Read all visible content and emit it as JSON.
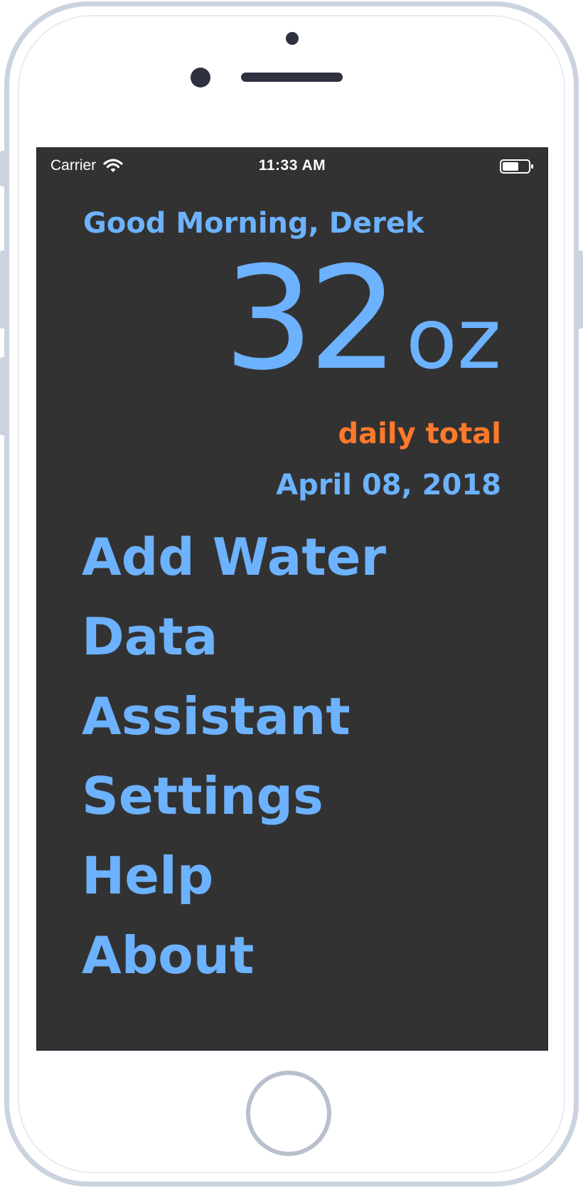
{
  "status_bar": {
    "carrier": "Carrier",
    "time": "11:33 AM",
    "wifi_icon": "wifi-icon",
    "battery_icon": "battery-icon"
  },
  "home": {
    "greeting": "Good Morning, Derek",
    "total_value": "32",
    "total_unit": "oz",
    "total_label": "daily total",
    "date": "April 08, 2018"
  },
  "menu": {
    "items": [
      {
        "label": "Add Water"
      },
      {
        "label": "Data"
      },
      {
        "label": "Assistant"
      },
      {
        "label": "Settings"
      },
      {
        "label": "Help"
      },
      {
        "label": "About"
      }
    ]
  },
  "colors": {
    "background": "#333232",
    "accent_blue": "#6cb2ff",
    "accent_orange": "#ff7a2b",
    "device_frame": "#ccd3e0"
  }
}
